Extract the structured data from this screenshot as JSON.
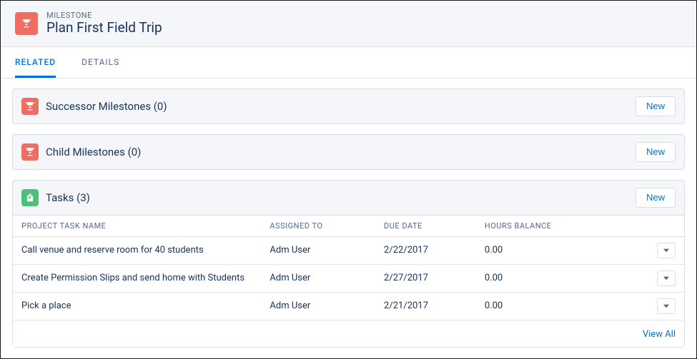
{
  "header": {
    "label": "MILESTONE",
    "title": "Plan First Field Trip"
  },
  "tabs": {
    "related": "RELATED",
    "details": "DETAILS"
  },
  "related_lists": {
    "successor": {
      "title": "Successor Milestones (0)",
      "new_btn": "New"
    },
    "child": {
      "title": "Child Milestones (0)",
      "new_btn": "New"
    },
    "tasks": {
      "title": "Tasks (3)",
      "new_btn": "New",
      "cols": {
        "name": "PROJECT TASK NAME",
        "assigned": "ASSIGNED TO",
        "due": "DUE DATE",
        "hours": "HOURS BALANCE"
      },
      "rows": [
        {
          "name": "Call venue and reserve room for 40 students",
          "assigned": "Adm User",
          "due": "2/22/2017",
          "hours": "0.00"
        },
        {
          "name": "Create Permission Slips and send home with Students",
          "assigned": "Adm User",
          "due": "2/27/2017",
          "hours": "0.00"
        },
        {
          "name": "Pick a place",
          "assigned": "Adm User",
          "due": "2/21/2017",
          "hours": "0.00"
        }
      ],
      "view_all": "View All"
    }
  }
}
